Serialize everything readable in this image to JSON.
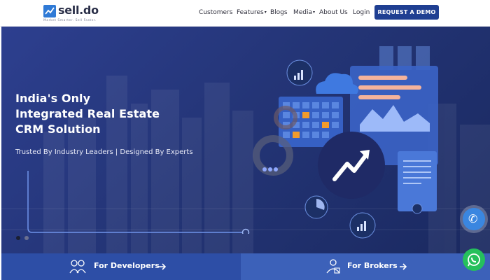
{
  "brand": {
    "name": "sell.do",
    "tagline": "Market Smarter. Sell Faster."
  },
  "nav": {
    "items": [
      {
        "label": "Customers",
        "has_menu": false
      },
      {
        "label": "Features",
        "has_menu": true
      },
      {
        "label": "Blogs",
        "has_menu": false
      },
      {
        "label": "Media",
        "has_menu": true
      },
      {
        "label": "About Us",
        "has_menu": false
      },
      {
        "label": "Login",
        "has_menu": false
      }
    ],
    "cta_label": "REQUEST A DEMO"
  },
  "hero": {
    "headline_1": "India's Only",
    "headline_2": "Integrated Real Estate",
    "headline_3": "CRM Solution",
    "subheadline": "Trusted By Industry Leaders | Designed By Experts",
    "slider_position": 1,
    "slider_count": 2
  },
  "bottom_bar": {
    "developers_label": "For Developers",
    "brokers_label": "For Brokers"
  },
  "colors": {
    "brand_blue": "#1f3f92",
    "hero_bg": "#243577",
    "accent_orange": "#f29b2b",
    "whatsapp_green": "#25c05c",
    "phone_blue": "#3a86e0"
  },
  "icons": [
    "logo-mark-icon",
    "caret-down-icon",
    "phone-icon",
    "whatsapp-icon",
    "developers-icon",
    "brokers-icon",
    "arrow-right-icon",
    "cloud-icon",
    "gear-icon",
    "calendar-icon",
    "growth-chart-icon",
    "document-icon",
    "pie-chart-icon"
  ]
}
